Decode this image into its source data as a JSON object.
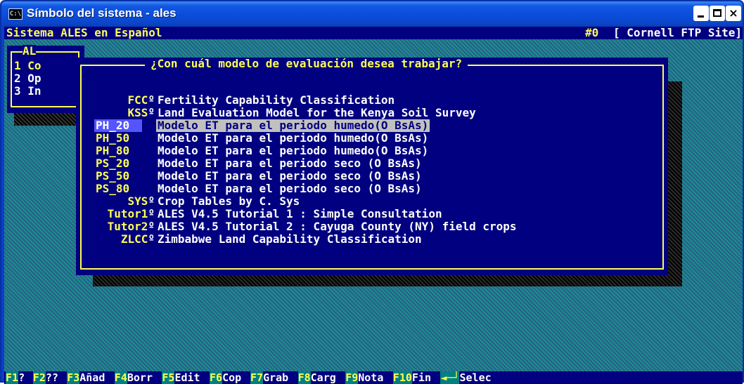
{
  "window": {
    "title": "Símbolo del sistema - ales",
    "icon_text": "C:\\",
    "controls": {
      "minimize": "_",
      "maximize": "□",
      "close": "×"
    }
  },
  "header": {
    "left": "Sistema ALES en Español",
    "num": "#0",
    "right": "[ Cornell FTP Site]"
  },
  "background_menu": {
    "title": "AL",
    "items": [
      "1 Co",
      "2 Op",
      "3 In"
    ]
  },
  "dialog": {
    "title": "¿Con cuál modelo de evaluación desea trabajar?",
    "items": [
      {
        "key": "FCC",
        "mark": "º",
        "desc": "Fertility Capability Classification"
      },
      {
        "key": "KSS",
        "mark": "º",
        "desc": "Land Evaluation Model for the Kenya Soil Survey"
      },
      {
        "key": "PH_20",
        "mark": "",
        "desc": "Modelo ET para el periodo humedo(O BsAs)",
        "selected": true
      },
      {
        "key": "PH_50",
        "mark": "",
        "desc": "Modelo ET para el periodo humedo(O BsAs)"
      },
      {
        "key": "PH_80",
        "mark": "",
        "desc": "Modelo ET para el periodo humedo(O BsAs)"
      },
      {
        "key": "PS_20",
        "mark": "",
        "desc": "Modelo ET para el periodo seco (O BsAs)"
      },
      {
        "key": "PS_50",
        "mark": "",
        "desc": "Modelo ET para el periodo seco (O BsAs)"
      },
      {
        "key": "PS_80",
        "mark": "",
        "desc": "Modelo ET para el periodo seco (O BsAs)"
      },
      {
        "key": "SYS",
        "mark": "º",
        "desc": "Crop Tables by C. Sys"
      },
      {
        "key": "Tutor1",
        "mark": "º",
        "desc": "ALES V4.5 Tutorial 1 : Simple Consultation"
      },
      {
        "key": "Tutor2",
        "mark": "º",
        "desc": "ALES V4.5 Tutorial 2 : Cayuga County (NY) field crops"
      },
      {
        "key": "ZLCC",
        "mark": "º",
        "desc": "Zimbabwe Land Capability Classification"
      }
    ]
  },
  "function_keys": [
    {
      "key": "F1",
      "label": "?"
    },
    {
      "key": "F2",
      "label": "??"
    },
    {
      "key": "F3",
      "label": "Añad"
    },
    {
      "key": "F4",
      "label": "Borr"
    },
    {
      "key": "F5",
      "label": "Edit"
    },
    {
      "key": "F6",
      "label": "Cop"
    },
    {
      "key": "F7",
      "label": "Grab"
    },
    {
      "key": "F8",
      "label": "Carg"
    },
    {
      "key": "F9",
      "label": "Nota"
    },
    {
      "key": "F10",
      "label": "Fin"
    },
    {
      "key": "◄─┘",
      "label": "Selec"
    }
  ],
  "colors": {
    "title_bar": "#0a4ddc",
    "console_bg": "#000080",
    "desktop_pattern": "#008080",
    "highlight_key": "#ffff55",
    "selection_bg": "#c0c0c0",
    "selection_key_bg": "#5555ff"
  }
}
